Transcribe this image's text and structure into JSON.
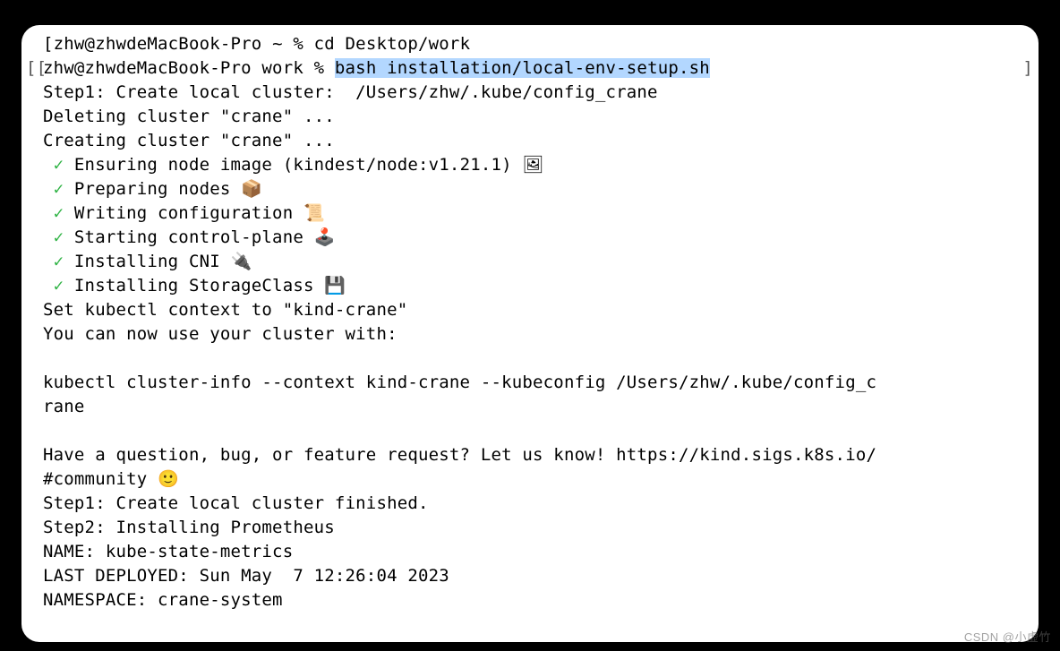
{
  "prompt1": {
    "bracket": "[",
    "user_host": "zhw@zhwdeMacBook-Pro",
    "dir": "~",
    "symbol": "%",
    "cmd": "cd Desktop/work"
  },
  "prompt2": {
    "bracket_left": "[[",
    "bracket_right": "]",
    "user_host": "zhw@zhwdeMacBook-Pro",
    "dir": "work",
    "symbol": "%",
    "cmd": "bash installation/local-env-setup.sh"
  },
  "output": {
    "step1_header": "Step1: Create local cluster:  /Users/zhw/.kube/config_crane",
    "deleting": "Deleting cluster \"crane\" ...",
    "creating": "Creating cluster \"crane\" ...",
    "checks": [
      {
        "text": "Ensuring node image (kindest/node:v1.21.1) ",
        "emoji": "🖼"
      },
      {
        "text": "Preparing nodes ",
        "emoji": "📦"
      },
      {
        "text": "Writing configuration ",
        "emoji": "📜"
      },
      {
        "text": "Starting control-plane ",
        "emoji": "🕹️"
      },
      {
        "text": "Installing CNI ",
        "emoji": "🔌"
      },
      {
        "text": "Installing StorageClass ",
        "emoji": "💾"
      }
    ],
    "set_context": "Set kubectl context to \"kind-crane\"",
    "use_cluster": "You can now use your cluster with:",
    "kubectl_line1": "kubectl cluster-info --context kind-crane --kubeconfig /Users/zhw/.kube/config_c",
    "kubectl_line2": "rane",
    "question_line1": "Have a question, bug, or feature request? Let us know! https://kind.sigs.k8s.io/",
    "question_line2_pre": "#community ",
    "question_emoji": "🙂",
    "step1_finished": "Step1: Create local cluster finished.",
    "step2": "Step2: Installing Prometheus",
    "name": "NAME: kube-state-metrics",
    "last_deployed": "LAST DEPLOYED: Sun May  7 12:26:04 2023",
    "namespace": "NAMESPACE: crane-system"
  },
  "watermark": "CSDN @小虚竹"
}
